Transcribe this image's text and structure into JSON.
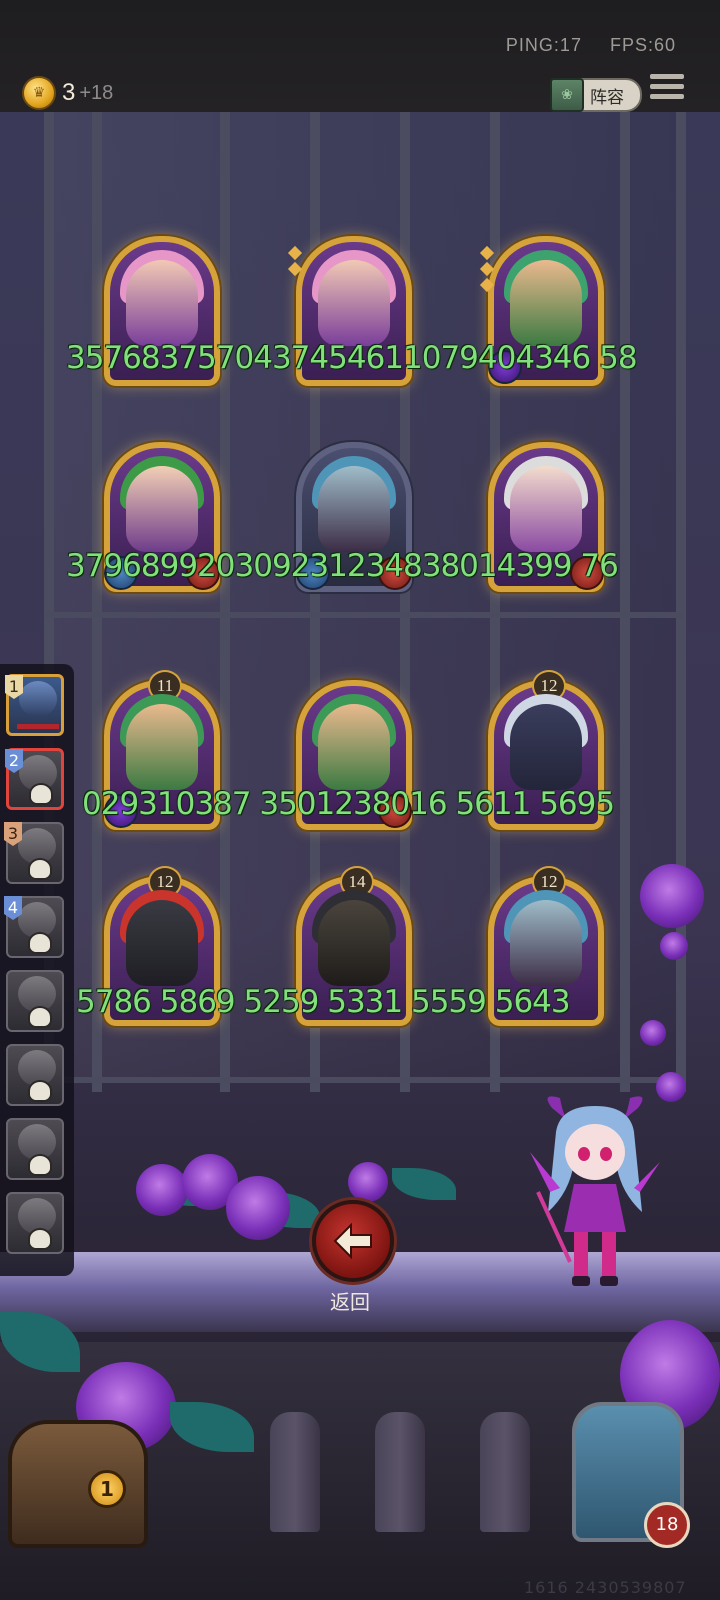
{
  "hud": {
    "ping": "PING:17",
    "fps": "FPS:60",
    "coins": "3",
    "coin_bonus": "+18",
    "lineup_label": "阵容"
  },
  "top_cards": [
    {
      "hair": "#e796c8",
      "theme": "gold"
    },
    {
      "hair": "#e796c8",
      "theme": "gold"
    },
    {
      "hair": "#3da36e",
      "theme": "gold"
    },
    {
      "hair": "#3d9a46",
      "theme": "gold"
    },
    {
      "hair": "#4f95b8",
      "theme": "plain"
    },
    {
      "hair": "#dcdcdc",
      "theme": "gold"
    }
  ],
  "number_rows": {
    "row1": "3576837570437454611079404346 58",
    "row2": "379689920309231234838014399 76",
    "row3": "029310387 3501238016  5611 5695",
    "row4": "5786 5869  5259 5331  5559 5643"
  },
  "enemy_cards": [
    {
      "level": "11",
      "hair": "#3d9a56"
    },
    {
      "level": "",
      "hair": "#3d9a56"
    },
    {
      "level": "12",
      "hair": "#cfd6e4"
    },
    {
      "level": "12",
      "hair": "#c9342c"
    },
    {
      "level": "14",
      "hair": "#2e2e34"
    },
    {
      "level": "12",
      "hair": "#4f95b8"
    }
  ],
  "queue": [
    {
      "badge": "1",
      "kind": "first"
    },
    {
      "badge": "2",
      "kind": "active"
    },
    {
      "badge": "3",
      "kind": "bronze"
    },
    {
      "badge": "4",
      "kind": "blue"
    },
    {
      "badge": "",
      "kind": "plain"
    },
    {
      "badge": "",
      "kind": "plain"
    },
    {
      "badge": "",
      "kind": "plain"
    },
    {
      "badge": "",
      "kind": "plain"
    }
  ],
  "back_label": "返回",
  "chest_count": "1",
  "player_level": "18",
  "footer_id": "1616 2430539807"
}
